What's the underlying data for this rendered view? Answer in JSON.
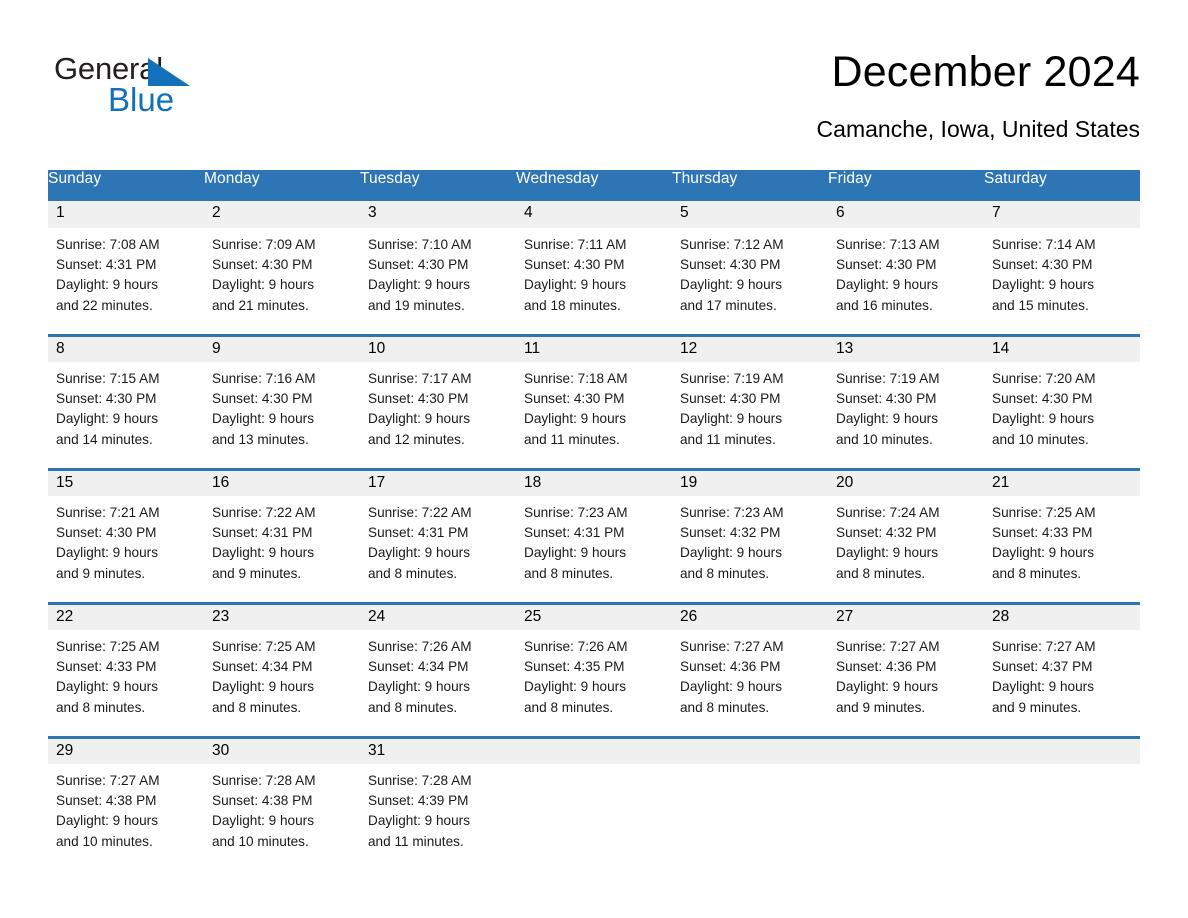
{
  "logo": {
    "word_dark": "General",
    "word_blue": "Blue",
    "triangle_color": "#1271b8"
  },
  "header": {
    "title": "December 2024",
    "subtitle": "Camanche, Iowa, United States",
    "header_bg_color": "#2e75b6",
    "daynum_bg_color": "#f0f0f0"
  },
  "weekday_headers": [
    "Sunday",
    "Monday",
    "Tuesday",
    "Wednesday",
    "Thursday",
    "Friday",
    "Saturday"
  ],
  "weeks": [
    {
      "days": [
        {
          "num": "1",
          "sunrise": "Sunrise: 7:08 AM",
          "sunset": "Sunset: 4:31 PM",
          "daylight1": "Daylight: 9 hours",
          "daylight2": "and 22 minutes."
        },
        {
          "num": "2",
          "sunrise": "Sunrise: 7:09 AM",
          "sunset": "Sunset: 4:30 PM",
          "daylight1": "Daylight: 9 hours",
          "daylight2": "and 21 minutes."
        },
        {
          "num": "3",
          "sunrise": "Sunrise: 7:10 AM",
          "sunset": "Sunset: 4:30 PM",
          "daylight1": "Daylight: 9 hours",
          "daylight2": "and 19 minutes."
        },
        {
          "num": "4",
          "sunrise": "Sunrise: 7:11 AM",
          "sunset": "Sunset: 4:30 PM",
          "daylight1": "Daylight: 9 hours",
          "daylight2": "and 18 minutes."
        },
        {
          "num": "5",
          "sunrise": "Sunrise: 7:12 AM",
          "sunset": "Sunset: 4:30 PM",
          "daylight1": "Daylight: 9 hours",
          "daylight2": "and 17 minutes."
        },
        {
          "num": "6",
          "sunrise": "Sunrise: 7:13 AM",
          "sunset": "Sunset: 4:30 PM",
          "daylight1": "Daylight: 9 hours",
          "daylight2": "and 16 minutes."
        },
        {
          "num": "7",
          "sunrise": "Sunrise: 7:14 AM",
          "sunset": "Sunset: 4:30 PM",
          "daylight1": "Daylight: 9 hours",
          "daylight2": "and 15 minutes."
        }
      ]
    },
    {
      "days": [
        {
          "num": "8",
          "sunrise": "Sunrise: 7:15 AM",
          "sunset": "Sunset: 4:30 PM",
          "daylight1": "Daylight: 9 hours",
          "daylight2": "and 14 minutes."
        },
        {
          "num": "9",
          "sunrise": "Sunrise: 7:16 AM",
          "sunset": "Sunset: 4:30 PM",
          "daylight1": "Daylight: 9 hours",
          "daylight2": "and 13 minutes."
        },
        {
          "num": "10",
          "sunrise": "Sunrise: 7:17 AM",
          "sunset": "Sunset: 4:30 PM",
          "daylight1": "Daylight: 9 hours",
          "daylight2": "and 12 minutes."
        },
        {
          "num": "11",
          "sunrise": "Sunrise: 7:18 AM",
          "sunset": "Sunset: 4:30 PM",
          "daylight1": "Daylight: 9 hours",
          "daylight2": "and 11 minutes."
        },
        {
          "num": "12",
          "sunrise": "Sunrise: 7:19 AM",
          "sunset": "Sunset: 4:30 PM",
          "daylight1": "Daylight: 9 hours",
          "daylight2": "and 11 minutes."
        },
        {
          "num": "13",
          "sunrise": "Sunrise: 7:19 AM",
          "sunset": "Sunset: 4:30 PM",
          "daylight1": "Daylight: 9 hours",
          "daylight2": "and 10 minutes."
        },
        {
          "num": "14",
          "sunrise": "Sunrise: 7:20 AM",
          "sunset": "Sunset: 4:30 PM",
          "daylight1": "Daylight: 9 hours",
          "daylight2": "and 10 minutes."
        }
      ]
    },
    {
      "days": [
        {
          "num": "15",
          "sunrise": "Sunrise: 7:21 AM",
          "sunset": "Sunset: 4:30 PM",
          "daylight1": "Daylight: 9 hours",
          "daylight2": "and 9 minutes."
        },
        {
          "num": "16",
          "sunrise": "Sunrise: 7:22 AM",
          "sunset": "Sunset: 4:31 PM",
          "daylight1": "Daylight: 9 hours",
          "daylight2": "and 9 minutes."
        },
        {
          "num": "17",
          "sunrise": "Sunrise: 7:22 AM",
          "sunset": "Sunset: 4:31 PM",
          "daylight1": "Daylight: 9 hours",
          "daylight2": "and 8 minutes."
        },
        {
          "num": "18",
          "sunrise": "Sunrise: 7:23 AM",
          "sunset": "Sunset: 4:31 PM",
          "daylight1": "Daylight: 9 hours",
          "daylight2": "and 8 minutes."
        },
        {
          "num": "19",
          "sunrise": "Sunrise: 7:23 AM",
          "sunset": "Sunset: 4:32 PM",
          "daylight1": "Daylight: 9 hours",
          "daylight2": "and 8 minutes."
        },
        {
          "num": "20",
          "sunrise": "Sunrise: 7:24 AM",
          "sunset": "Sunset: 4:32 PM",
          "daylight1": "Daylight: 9 hours",
          "daylight2": "and 8 minutes."
        },
        {
          "num": "21",
          "sunrise": "Sunrise: 7:25 AM",
          "sunset": "Sunset: 4:33 PM",
          "daylight1": "Daylight: 9 hours",
          "daylight2": "and 8 minutes."
        }
      ]
    },
    {
      "days": [
        {
          "num": "22",
          "sunrise": "Sunrise: 7:25 AM",
          "sunset": "Sunset: 4:33 PM",
          "daylight1": "Daylight: 9 hours",
          "daylight2": "and 8 minutes."
        },
        {
          "num": "23",
          "sunrise": "Sunrise: 7:25 AM",
          "sunset": "Sunset: 4:34 PM",
          "daylight1": "Daylight: 9 hours",
          "daylight2": "and 8 minutes."
        },
        {
          "num": "24",
          "sunrise": "Sunrise: 7:26 AM",
          "sunset": "Sunset: 4:34 PM",
          "daylight1": "Daylight: 9 hours",
          "daylight2": "and 8 minutes."
        },
        {
          "num": "25",
          "sunrise": "Sunrise: 7:26 AM",
          "sunset": "Sunset: 4:35 PM",
          "daylight1": "Daylight: 9 hours",
          "daylight2": "and 8 minutes."
        },
        {
          "num": "26",
          "sunrise": "Sunrise: 7:27 AM",
          "sunset": "Sunset: 4:36 PM",
          "daylight1": "Daylight: 9 hours",
          "daylight2": "and 8 minutes."
        },
        {
          "num": "27",
          "sunrise": "Sunrise: 7:27 AM",
          "sunset": "Sunset: 4:36 PM",
          "daylight1": "Daylight: 9 hours",
          "daylight2": "and 9 minutes."
        },
        {
          "num": "28",
          "sunrise": "Sunrise: 7:27 AM",
          "sunset": "Sunset: 4:37 PM",
          "daylight1": "Daylight: 9 hours",
          "daylight2": "and 9 minutes."
        }
      ]
    },
    {
      "days": [
        {
          "num": "29",
          "sunrise": "Sunrise: 7:27 AM",
          "sunset": "Sunset: 4:38 PM",
          "daylight1": "Daylight: 9 hours",
          "daylight2": "and 10 minutes."
        },
        {
          "num": "30",
          "sunrise": "Sunrise: 7:28 AM",
          "sunset": "Sunset: 4:38 PM",
          "daylight1": "Daylight: 9 hours",
          "daylight2": "and 10 minutes."
        },
        {
          "num": "31",
          "sunrise": "Sunrise: 7:28 AM",
          "sunset": "Sunset: 4:39 PM",
          "daylight1": "Daylight: 9 hours",
          "daylight2": "and 11 minutes."
        },
        {
          "num": "",
          "sunrise": "",
          "sunset": "",
          "daylight1": "",
          "daylight2": ""
        },
        {
          "num": "",
          "sunrise": "",
          "sunset": "",
          "daylight1": "",
          "daylight2": ""
        },
        {
          "num": "",
          "sunrise": "",
          "sunset": "",
          "daylight1": "",
          "daylight2": ""
        },
        {
          "num": "",
          "sunrise": "",
          "sunset": "",
          "daylight1": "",
          "daylight2": ""
        }
      ]
    }
  ]
}
